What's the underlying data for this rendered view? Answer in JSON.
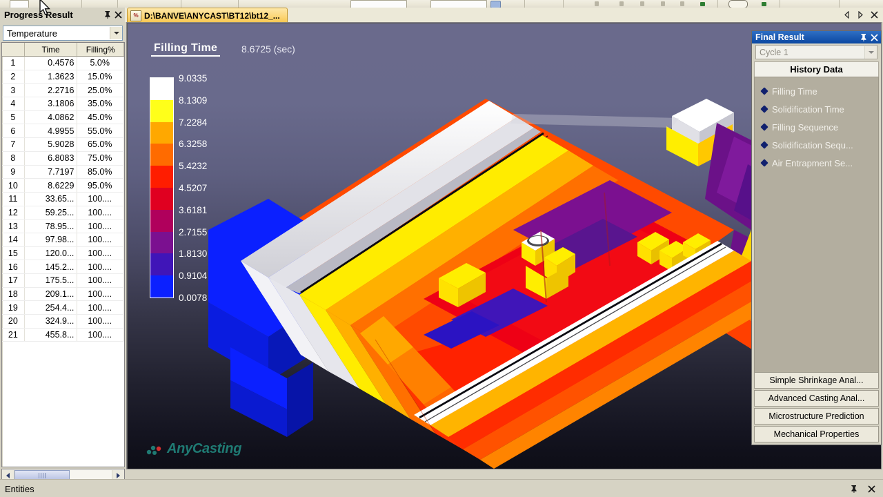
{
  "left_panel": {
    "title": "Progress Result",
    "pin_icon": "pin-icon",
    "close_icon": "close-icon",
    "selector": {
      "value": "Temperature",
      "icon": "chevron-down-icon"
    },
    "table": {
      "headers": [
        "",
        "Time",
        "Filling%"
      ],
      "rows": [
        [
          "1",
          "0.4576",
          "5.0%"
        ],
        [
          "2",
          "1.3623",
          "15.0%"
        ],
        [
          "3",
          "2.2716",
          "25.0%"
        ],
        [
          "4",
          "3.1806",
          "35.0%"
        ],
        [
          "5",
          "4.0862",
          "45.0%"
        ],
        [
          "6",
          "4.9955",
          "55.0%"
        ],
        [
          "7",
          "5.9028",
          "65.0%"
        ],
        [
          "8",
          "6.8083",
          "75.0%"
        ],
        [
          "9",
          "7.7197",
          "85.0%"
        ],
        [
          "10",
          "8.6229",
          "95.0%"
        ],
        [
          "11",
          "33.65...",
          "100...."
        ],
        [
          "12",
          "59.25...",
          "100...."
        ],
        [
          "13",
          "78.95...",
          "100...."
        ],
        [
          "14",
          "97.98...",
          "100...."
        ],
        [
          "15",
          "120.0...",
          "100...."
        ],
        [
          "16",
          "145.2...",
          "100...."
        ],
        [
          "17",
          "175.5...",
          "100...."
        ],
        [
          "18",
          "209.1...",
          "100...."
        ],
        [
          "19",
          "254.4...",
          "100...."
        ],
        [
          "20",
          "324.9...",
          "100...."
        ],
        [
          "21",
          "455.8...",
          "100...."
        ]
      ]
    },
    "scrollbar": {
      "left_icon": "arrow-left-icon",
      "right_icon": "arrow-right-icon"
    }
  },
  "document_tab": {
    "label": "D:\\BANVE\\ANYCAST\\BT12\\bt12_...",
    "icon": "document-icon",
    "nav": {
      "prev_icon": "triangle-left-icon",
      "next_icon": "triangle-right-icon",
      "close_icon": "close-icon"
    }
  },
  "viewport": {
    "result_title": "Filling Time",
    "result_value": "8.6725 (sec)",
    "logo_text": "AnyCasting",
    "background_top": "#6a6a8c",
    "background_bottom": "#0d0d16"
  },
  "chart_data": {
    "type": "heatmap",
    "title": "Filling Time",
    "subtitle": "8.6725 (sec)",
    "unit": "sec",
    "legend_position": "left",
    "colorbar_labels": [
      "9.0335",
      "8.1309",
      "7.2284",
      "6.3258",
      "5.4232",
      "4.5207",
      "3.6181",
      "2.7155",
      "1.8130",
      "0.9104",
      "0.0078"
    ],
    "colorbar_values": [
      9.0335,
      8.1309,
      7.2284,
      6.3258,
      5.4232,
      4.5207,
      3.6181,
      2.7155,
      1.813,
      0.9104,
      0.0078
    ],
    "band_colors": [
      "#ffffff",
      "#ffff1a",
      "#ffa800",
      "#ff6b00",
      "#ff1d00",
      "#e00020",
      "#b0005c",
      "#7b1090",
      "#4015b8",
      "#0b20ff"
    ],
    "range": [
      0.0078,
      9.0335
    ],
    "bands": 10
  },
  "right_panel": {
    "title": "Final Result",
    "pin_icon": "pin-icon",
    "close_icon": "close-icon",
    "cycle_selector": {
      "value": "Cycle 1",
      "icon": "chevron-down-icon"
    },
    "history_header": "History Data",
    "items": [
      {
        "label": "Filling Time"
      },
      {
        "label": "Solidification Time"
      },
      {
        "label": "Filling Sequence"
      },
      {
        "label": "Solidification Sequ..."
      },
      {
        "label": "Air Entrapment Se..."
      }
    ],
    "buttons": [
      {
        "label": "Simple Shrinkage Anal..."
      },
      {
        "label": "Advanced Casting Anal..."
      },
      {
        "label": "Microstructure Prediction"
      },
      {
        "label": "Mechanical Properties"
      }
    ]
  },
  "statusbar": {
    "text": "Entities",
    "pin_icon": "pin-icon",
    "close_icon": "close-icon"
  }
}
